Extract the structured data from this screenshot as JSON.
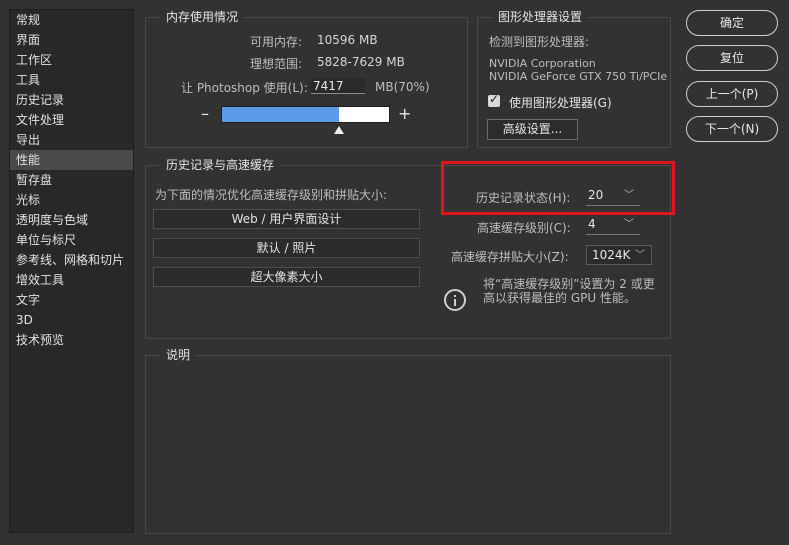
{
  "sidebar": {
    "items": [
      {
        "label": "常规"
      },
      {
        "label": "界面"
      },
      {
        "label": "工作区"
      },
      {
        "label": "工具"
      },
      {
        "label": "历史记录"
      },
      {
        "label": "文件处理"
      },
      {
        "label": "导出"
      },
      {
        "label": "性能",
        "active": true
      },
      {
        "label": "暂存盘"
      },
      {
        "label": "光标"
      },
      {
        "label": "透明度与色域"
      },
      {
        "label": "单位与标尺"
      },
      {
        "label": "参考线、网格和切片"
      },
      {
        "label": "增效工具"
      },
      {
        "label": "文字"
      },
      {
        "label": "3D"
      },
      {
        "label": "技术预览"
      }
    ]
  },
  "memory": {
    "title": "内存使用情况",
    "available_label": "可用内存:",
    "available_value": "10596 MB",
    "ideal_label": "理想范围:",
    "ideal_value": "5828-7629 MB",
    "let_label": "让 Photoshop 使用(L):",
    "let_value": "7417",
    "let_unit": "MB(70%)",
    "minus": "–",
    "plus": "+",
    "usage_fraction": 0.7
  },
  "gpu": {
    "title": "图形处理器设置",
    "detected_label": "检测到图形处理器:",
    "vendor": "NVIDIA Corporation",
    "model": "NVIDIA GeForce GTX 750 Ti/PCIe",
    "use_gpu_label": "使用图形处理器(G)",
    "use_gpu_checked": true,
    "advanced_label": "高级设置..."
  },
  "history_cache": {
    "title": "历史记录与高速缓存",
    "optimize_label": "为下面的情况优化高速缓存级别和拼贴大小:",
    "presets": [
      "Web / 用户界面设计",
      "默认 / 照片",
      "超大像素大小"
    ],
    "history_states_label": "历史记录状态(H):",
    "history_states_value": "20",
    "cache_levels_label": "高速缓存级别(C):",
    "cache_levels_value": "4",
    "tile_size_label": "高速缓存拼贴大小(Z):",
    "tile_size_value": "1024K",
    "info_line1": "将“高速缓存级别”设置为 2 或更",
    "info_line2": "高以获得最佳的 GPU 性能。"
  },
  "description": {
    "title": "说明"
  },
  "buttons": {
    "ok": "确定",
    "reset": "复位",
    "prev": "上一个(P)",
    "next": "下一个(N)"
  },
  "colors": {
    "accent_fill": "#5b9ae6",
    "highlight": "#e0141c"
  }
}
